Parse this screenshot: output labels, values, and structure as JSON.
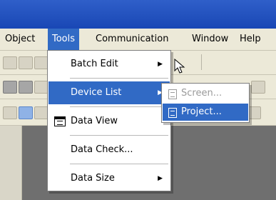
{
  "menubar": {
    "items": [
      "Object",
      "Tools",
      "Communication",
      "Window",
      "Help"
    ]
  },
  "tools_menu": {
    "items": [
      {
        "label": "Batch Edit",
        "has_submenu": true
      },
      {
        "label": "Device List",
        "has_submenu": true
      },
      {
        "label": "Data View",
        "has_submenu": false,
        "icon": "data-view-icon"
      },
      {
        "label": "Data Check...",
        "has_submenu": false
      },
      {
        "label": "Data Size",
        "has_submenu": true
      }
    ],
    "arrow": "▶"
  },
  "device_list_submenu": {
    "items": [
      {
        "label": "Screen...",
        "enabled": false,
        "icon": "screen-icon"
      },
      {
        "label": "Project...",
        "enabled": true,
        "icon": "project-icon"
      }
    ]
  },
  "colors": {
    "highlight": "#316ac5",
    "titlebar": "#2f5fc9",
    "menubar": "#ece9d8",
    "workarea": "#6f6f6f"
  }
}
